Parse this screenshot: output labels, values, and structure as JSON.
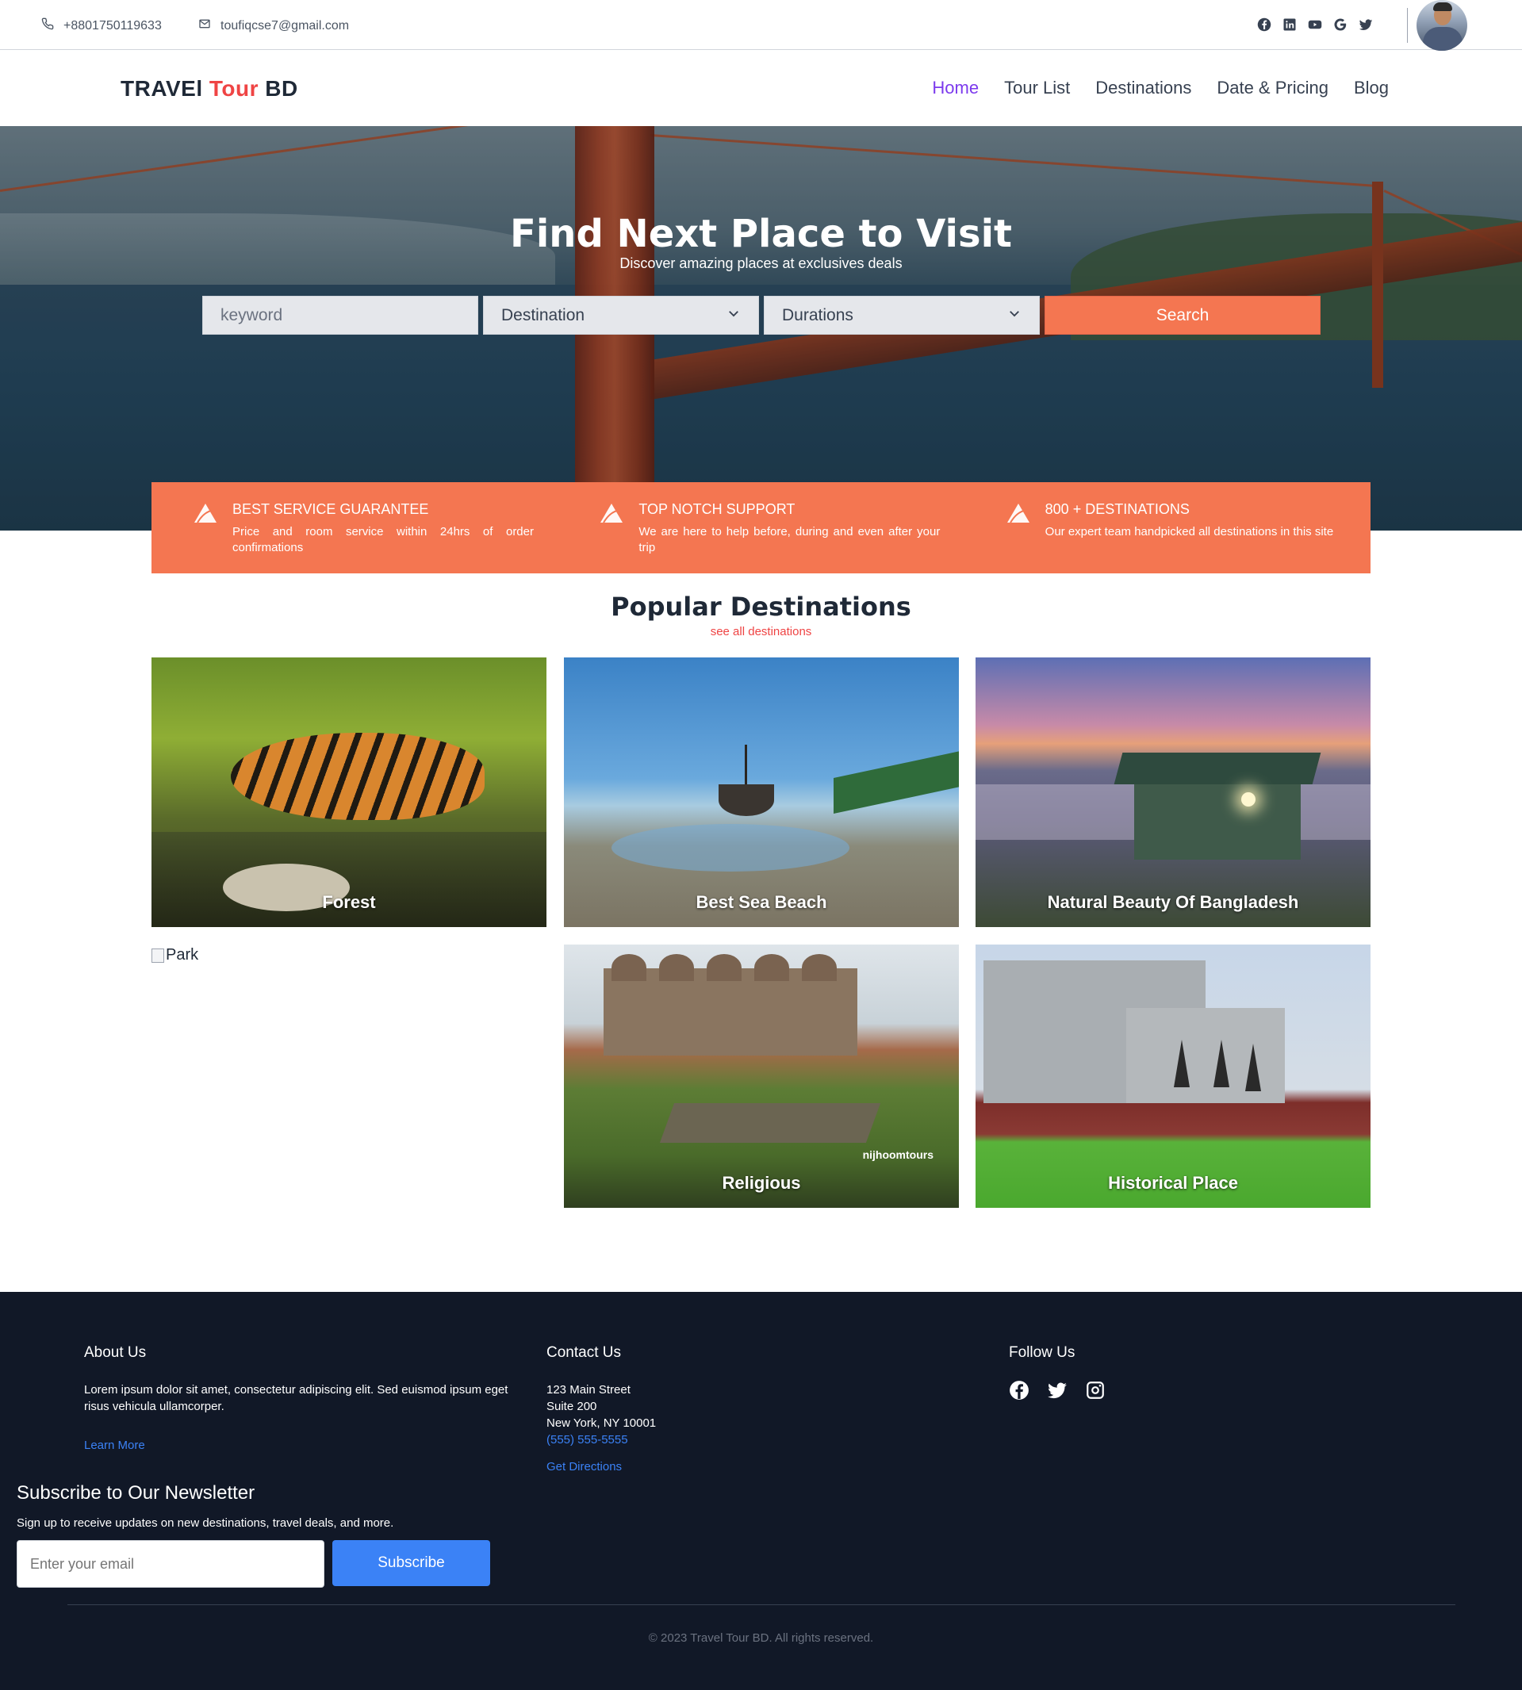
{
  "topbar": {
    "phone": "+8801750119633",
    "email": "toufiqcse7@gmail.com",
    "socials": [
      "facebook-icon",
      "linkedin-icon",
      "youtube-icon",
      "google-icon",
      "twitter-icon"
    ]
  },
  "nav": {
    "logo_part1": "TRAVEl ",
    "logo_part2": "Tour",
    "logo_part3": " BD",
    "items": [
      "Home",
      "Tour List",
      "Destinations",
      "Date & Pricing",
      "Blog"
    ],
    "active": "Home"
  },
  "hero": {
    "title": "Find Next Place to Visit",
    "subtitle": "Discover amazing places at exclusives deals",
    "keyword_placeholder": "keyword",
    "destination_value": "Destination",
    "durations_value": "Durations",
    "search_label": "Search"
  },
  "features": [
    {
      "title": "BEST SERVICE GUARANTEE",
      "desc": "Price and room service within 24hrs of order confirmations"
    },
    {
      "title": "TOP NOTCH SUPPORT",
      "desc": "We are here to help before, during and even after your trip"
    },
    {
      "title": "800 + DESTINATIONS",
      "desc": "Our expert team handpicked all destinations in this site"
    }
  ],
  "popular": {
    "title": "Popular Destinations",
    "link": "see all destinations",
    "cards": [
      "Forest",
      "Best Sea Beach",
      "Natural Beauty Of Bangladesh",
      "Park",
      "Religious",
      "Historical Place"
    ],
    "watermark": "nijhoomtours"
  },
  "footer": {
    "about_title": "About Us",
    "about_text": "Lorem ipsum dolor sit amet, consectetur adipiscing elit. Sed euismod ipsum eget risus vehicula ullamcorper.",
    "learn_more": "Learn More",
    "contact_title": "Contact Us",
    "address1": "123 Main Street",
    "address2": "Suite 200",
    "address3": "New York, NY 10001",
    "phone": "(555) 555-5555",
    "directions": "Get Directions",
    "follow_title": "Follow Us",
    "follow_icons": [
      "facebook-icon",
      "twitter-icon",
      "instagram-icon"
    ],
    "newsletter_title": "Subscribe to Our Newsletter",
    "newsletter_sub": "Sign up to receive updates on new destinations, travel deals, and more.",
    "email_placeholder": "Enter your email",
    "subscribe_label": "Subscribe",
    "copyright": "© 2023 Travel Tour BD. All rights reserved."
  },
  "colors": {
    "accent": "#f47651",
    "nav_active": "#7c3aed",
    "footer_bg": "#111827",
    "link_blue": "#3b82f6"
  }
}
